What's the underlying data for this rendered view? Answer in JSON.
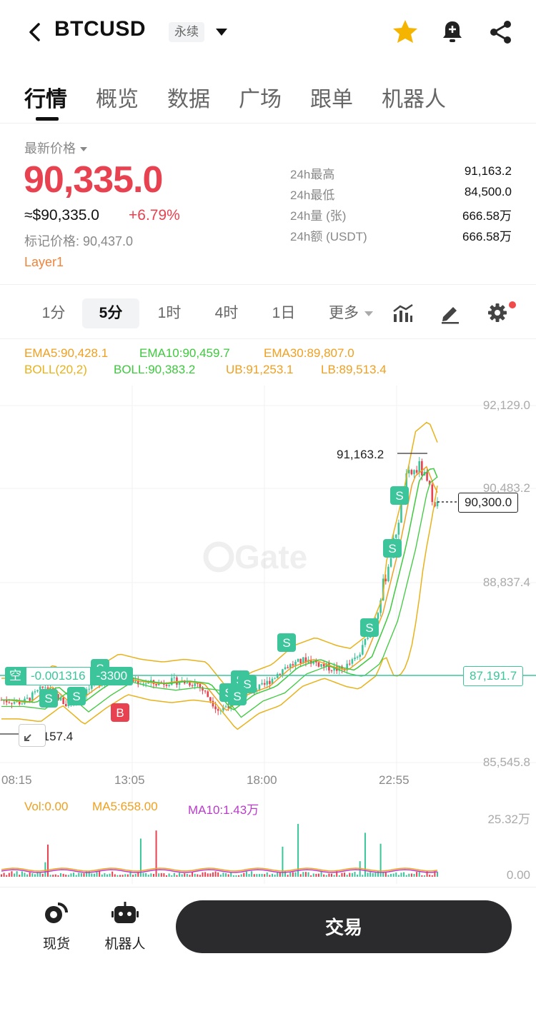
{
  "header": {
    "symbol": "BTCUSD",
    "contract_type": "永续"
  },
  "tabs": [
    {
      "label": "行情",
      "active": true
    },
    {
      "label": "概览"
    },
    {
      "label": "数据"
    },
    {
      "label": "广场"
    },
    {
      "label": "跟单"
    },
    {
      "label": "机器人"
    }
  ],
  "price": {
    "latest_label": "最新价格",
    "last": "90,335.0",
    "usd": "≈$90,335.0",
    "change": "+6.79%",
    "mark_price": "标记价格: 90,437.0",
    "tag": "Layer1"
  },
  "stats": [
    {
      "label": "24h最高",
      "value": "91,163.2"
    },
    {
      "label": "24h最低",
      "value": "84,500.0"
    },
    {
      "label": "24h量 (张)",
      "value": "666.58万"
    },
    {
      "label": "24h额 (USDT)",
      "value": "666.58万"
    }
  ],
  "intervals": [
    {
      "label": "1分"
    },
    {
      "label": "5分",
      "selected": true
    },
    {
      "label": "1时"
    },
    {
      "label": "4时"
    },
    {
      "label": "1日"
    },
    {
      "label": "更多"
    }
  ],
  "indicators": {
    "ema5": "EMA5:90,428.1",
    "ema10": "EMA10:90,459.7",
    "ema30": "EMA30:89,807.0",
    "boll": "BOLL(20,2)",
    "boll_mid": "BOLL:90,383.2",
    "ub": "UB:91,253.1",
    "lb": "LB:89,513.4"
  },
  "chart": {
    "watermark": "Gate",
    "y_ticks": [
      "92,129.0",
      "90,483.2",
      "88,837.4",
      "87,191.7",
      "85,545.8"
    ],
    "x_ticks": [
      "08:15",
      "13:05",
      "18:00",
      "22:55"
    ],
    "high_label": "91,163.2",
    "low_label": "86,157.4",
    "current_price_label": "90,300.0",
    "position": {
      "side": "空",
      "pnl": "-0.001316",
      "qty": "-3300",
      "price": "87,191.7"
    },
    "markers": {
      "sell": "S",
      "buy": "B"
    }
  },
  "volume": {
    "vol": "Vol:0.00",
    "ma5": "MA5:658.00",
    "ma10": "MA10:1.43万",
    "y_top": "25.32万",
    "y_bottom": "0.00"
  },
  "bottom": {
    "spot": "现货",
    "robot": "机器人",
    "trade": "交易"
  },
  "colors": {
    "up": "#3cc59b",
    "down": "#e8414f",
    "ema5": "#f0a020",
    "ema10": "#3ec93e",
    "ema30": "#e8b21a",
    "accent": "#f0843b",
    "star": "#f5b400"
  },
  "chart_data": {
    "type": "candlestick",
    "x": [
      "08:15",
      "13:05",
      "18:00",
      "22:55"
    ],
    "y_range": [
      85545.8,
      92129.0
    ],
    "series": [
      {
        "name": "EMA5",
        "values": [
          86650,
          87100,
          86900,
          87400,
          91100,
          90428.1
        ]
      },
      {
        "name": "EMA10",
        "values": [
          86600,
          87000,
          86850,
          87300,
          90800,
          90459.7
        ]
      },
      {
        "name": "EMA30",
        "values": [
          86500,
          86900,
          86700,
          87200,
          89500,
          89807.0
        ]
      },
      {
        "name": "UB",
        "values": [
          87000,
          87300,
          87100,
          87600,
          91800,
          91253.1
        ]
      },
      {
        "name": "LB",
        "values": [
          86100,
          86400,
          86200,
          86700,
          86500,
          89513.4
        ]
      }
    ],
    "high": 91163.2,
    "low": 86157.4,
    "last": 90300.0
  }
}
